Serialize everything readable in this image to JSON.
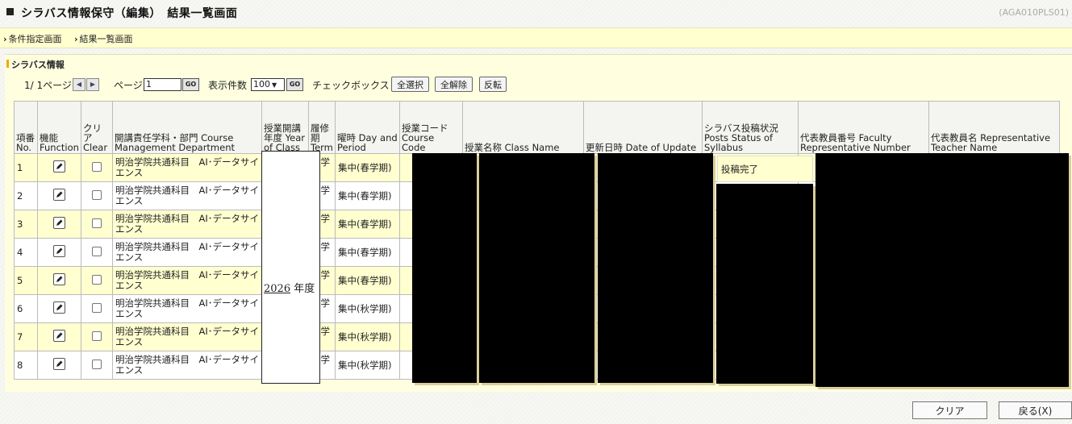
{
  "header": {
    "title": "シラバス情報保守（編集）　結果一覧画面",
    "screen_id": "(AGA010PLS01)"
  },
  "breadcrumb": [
    {
      "label": "条件指定画面"
    },
    {
      "label": "結果一覧画面"
    }
  ],
  "section": {
    "title": "シラバス情報"
  },
  "pager": {
    "page_info": "1/ 1ページ",
    "page_label": "ページ",
    "page_value": "1",
    "go_label": "GO",
    "per_page_label": "表示件数",
    "per_page_value": "100",
    "checkbox_label": "チェックボックス",
    "select_all": "全選択",
    "clear_all": "全解除",
    "invert": "反転"
  },
  "table": {
    "headers": {
      "no": "項番 No.",
      "function": "機能 Function",
      "clear": "クリア Clear",
      "dept": "開講責任学科・部門 Course Management Department",
      "year": "授業開講年度 Year of Class",
      "term": "履修期 Term",
      "day": "曜時 Day and Period",
      "code": "授業コード Course Code",
      "name": "授業名称 Class Name",
      "updated": "更新日時 Date of Update",
      "status": "シラバス投稿状況 Posts Status of Syllabus",
      "faculty_no": "代表教員番号 Faculty Representative Number",
      "teacher": "代表教員名 Representative Teacher Name"
    },
    "year_value": "2026",
    "year_suffix": "年度",
    "first_row_status": "投稿完了",
    "rows": [
      {
        "no": "1",
        "dept": "明治学院共通科目　AI･データサイエンス",
        "term": "春学期",
        "day": "集中(春学期)"
      },
      {
        "no": "2",
        "dept": "明治学院共通科目　AI･データサイエンス",
        "term": "春学期",
        "day": "集中(春学期)"
      },
      {
        "no": "3",
        "dept": "明治学院共通科目　AI･データサイエンス",
        "term": "春学期",
        "day": "集中(春学期)"
      },
      {
        "no": "4",
        "dept": "明治学院共通科目　AI･データサイエンス",
        "term": "春学期",
        "day": "集中(春学期)"
      },
      {
        "no": "5",
        "dept": "明治学院共通科目　AI･データサイエンス",
        "term": "春学期",
        "day": "集中(春学期)"
      },
      {
        "no": "6",
        "dept": "明治学院共通科目　AI･データサイエンス",
        "term": "秋学期",
        "day": "集中(秋学期)"
      },
      {
        "no": "7",
        "dept": "明治学院共通科目　AI･データサイエンス",
        "term": "秋学期",
        "day": "集中(秋学期)"
      },
      {
        "no": "8",
        "dept": "明治学院共通科目　AI･データサイエンス",
        "term": "秋学期",
        "day": "集中(秋学期)"
      }
    ]
  },
  "footer": {
    "clear": "クリア",
    "back": "戻る(X)"
  },
  "colors": {
    "highlight_row": "#ffffd0",
    "section_accent": "#f2a800"
  }
}
